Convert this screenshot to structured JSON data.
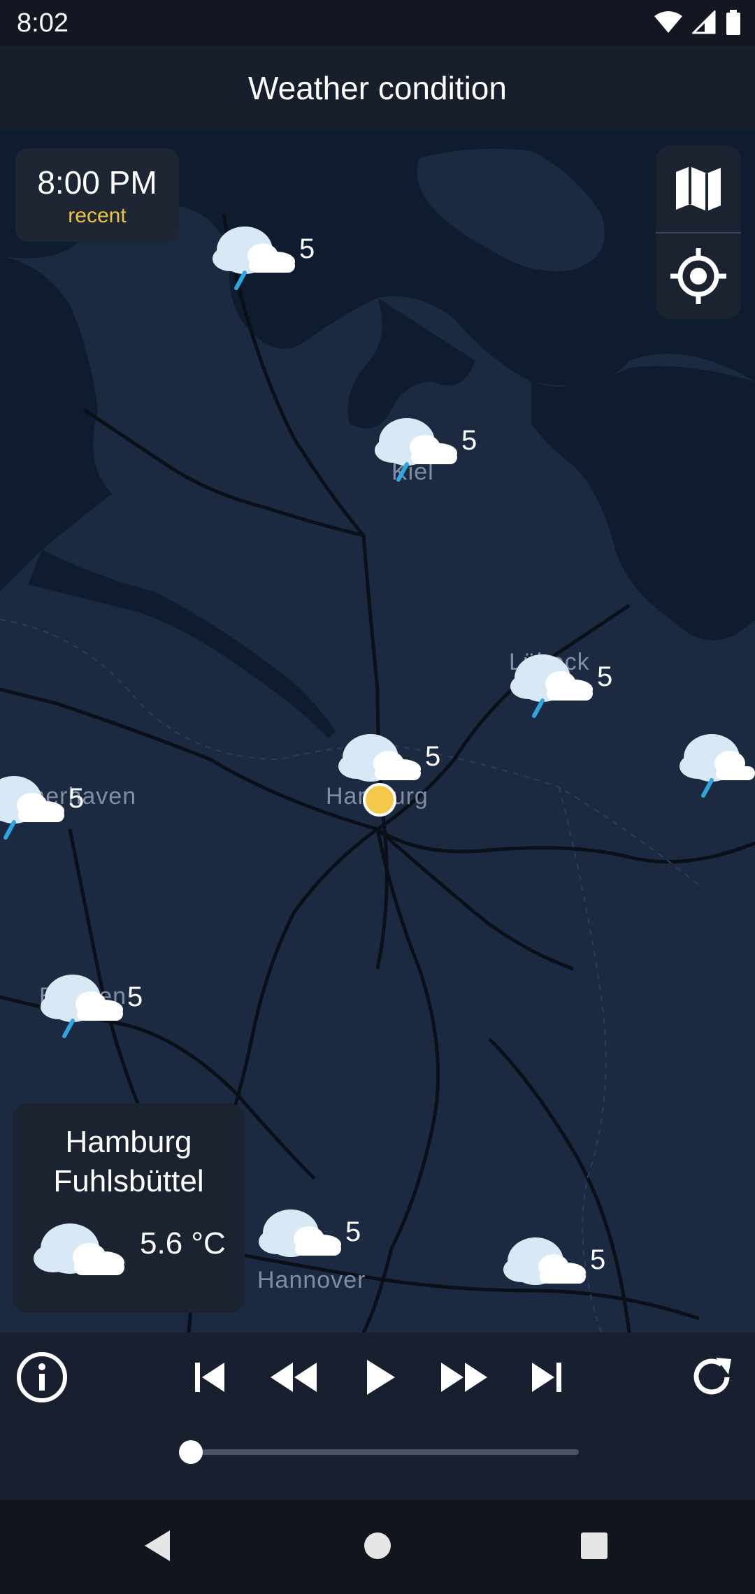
{
  "status_bar": {
    "time": "8:02"
  },
  "app_bar": {
    "title": "Weather condition"
  },
  "time_card": {
    "time": "8:00 PM",
    "status": "recent"
  },
  "map": {
    "cities": [
      "Kiel",
      "Lübeck",
      "Hamburg",
      "Bremerhaven",
      "Bremen",
      "Hannover"
    ],
    "markers": [
      {
        "value": "5",
        "condition": "cloud-rain-icon"
      },
      {
        "value": "5",
        "condition": "cloud-rain-icon"
      },
      {
        "value": "5",
        "condition": "cloud-rain-icon"
      },
      {
        "value": "5",
        "condition": "cloud-icon"
      },
      {
        "value": "5",
        "condition": "cloud-rain-icon"
      },
      {
        "value": "5",
        "condition": "cloud-rain-icon"
      },
      {
        "value": "5",
        "condition": "cloud-rain-icon"
      },
      {
        "value": "5",
        "condition": "cloud-icon"
      },
      {
        "value": "5",
        "condition": "cloud-icon"
      }
    ]
  },
  "station": {
    "name_line1": "Hamburg",
    "name_line2": "Fuhlsbüttel",
    "temperature": "5.6 °C",
    "condition": "cloud-icon"
  },
  "player": {
    "progress": 0.0
  },
  "colors": {
    "accent": "#f3c84b",
    "rain": "#2ea7e0",
    "map_bg": "#1b2a41",
    "panel": "#1b2230"
  }
}
